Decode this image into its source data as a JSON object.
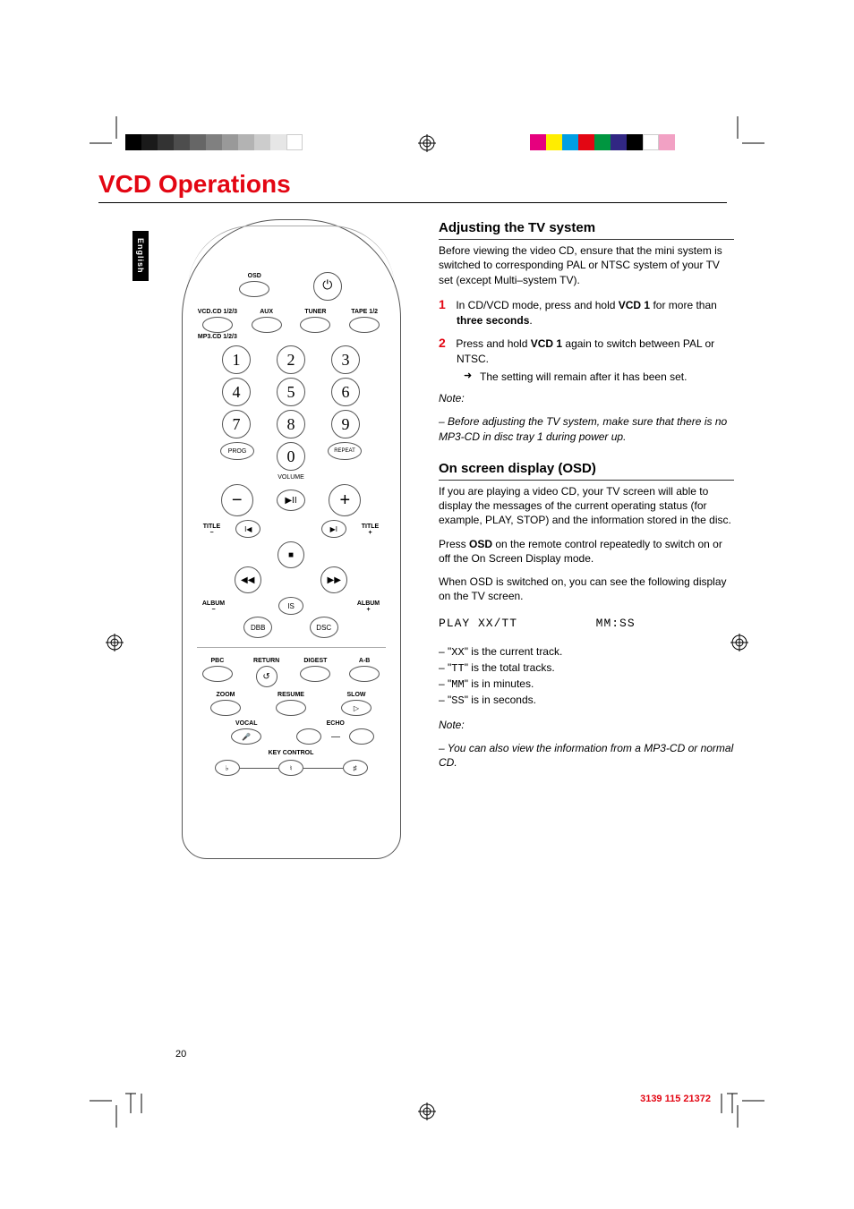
{
  "page": {
    "title": "VCD Operations",
    "language_tab": "English",
    "page_number": "20",
    "footer_code": "3139 115 21372"
  },
  "remote": {
    "top_row": {
      "osd": "OSD",
      "power": "⏻"
    },
    "source_row": {
      "left_top": "VCD.CD 1/2/3",
      "left_bottom": "MP3.CD 1/2/3",
      "center": "AUX",
      "right1": "TUNER",
      "right2": "TAPE 1/2"
    },
    "numbers": [
      "1",
      "2",
      "3",
      "4",
      "5",
      "6",
      "7",
      "8",
      "9",
      "0"
    ],
    "prog": "PROG",
    "repeat": "REPEAT",
    "volume_label": "VOLUME",
    "vol_minus": "−",
    "vol_plus": "+",
    "play_pause": "▶II",
    "title_minus": "TITLE\n−",
    "title_plus": "TITLE\n+",
    "prev": "I◀",
    "next": "▶I",
    "stop": "■",
    "rew": "◀◀",
    "ffwd": "▶▶",
    "album_minus": "ALBUM\n−",
    "album_plus": "ALBUM\n+",
    "is": "IS",
    "dbb": "DBB",
    "dsc": "DSC",
    "row_a": {
      "pbc": "PBC",
      "return": "RETURN",
      "digest": "DIGEST",
      "ab": "A-B"
    },
    "row_b": {
      "zoom": "ZOOM",
      "resume": "RESUME",
      "slow": "SLOW"
    },
    "row_c": {
      "vocal": "VOCAL",
      "echo": "ECHO"
    },
    "key_control": "KEY CONTROL",
    "kc_flat": "♭",
    "kc_nat": "♮",
    "kc_sharp": "♯",
    "return_icon": "↺",
    "slow_icon": "▷",
    "vocal_icon": "🎤"
  },
  "tv": {
    "heading": "Adjusting the TV system",
    "intro": "Before viewing the video CD, ensure that the mini system is switched to corresponding PAL or NTSC system of your TV set (except Multi–system TV).",
    "step1_num": "1",
    "step1_a": "In CD/VCD mode, press and hold ",
    "step1_b": "VCD 1",
    "step1_c": " for more than ",
    "step1_d": "three seconds",
    "step1_e": ".",
    "step2_num": "2",
    "step2_a": "Press and hold ",
    "step2_b": "VCD 1",
    "step2_c": " again to switch between PAL or NTSC.",
    "step2_result": "The setting will remain after it has been set.",
    "note_label": "Note:",
    "note_text": "–  Before adjusting the TV system, make sure that there is no MP3-CD in disc tray 1 during power up."
  },
  "osd": {
    "heading": "On screen display (OSD)",
    "p1": "If you are playing a video CD, your TV screen will able to display the messages of the current operating status (for example, PLAY, STOP) and the information stored in the disc.",
    "p2_a": "Press ",
    "p2_b": "OSD",
    "p2_c": " on the remote control repeatedly to switch on or off the On Screen Display mode.",
    "p3": "When OSD is switched on, you can see the following display on the TV screen.",
    "display_left": "PLAY   XX/TT",
    "display_right": "MM:SS",
    "li1_a": "\"",
    "li1_b": "XX",
    "li1_c": "\" is the current track.",
    "li2_a": "\"",
    "li2_b": "TT",
    "li2_c": "\" is the total tracks.",
    "li3_a": "\"",
    "li3_b": "MM",
    "li3_c": "\" is in minutes.",
    "li4_a": "\"",
    "li4_b": "SS",
    "li4_c": "\" is in seconds.",
    "note_label": "Note:",
    "note_text": "–  You can also view the information from a MP3-CD or normal CD."
  }
}
